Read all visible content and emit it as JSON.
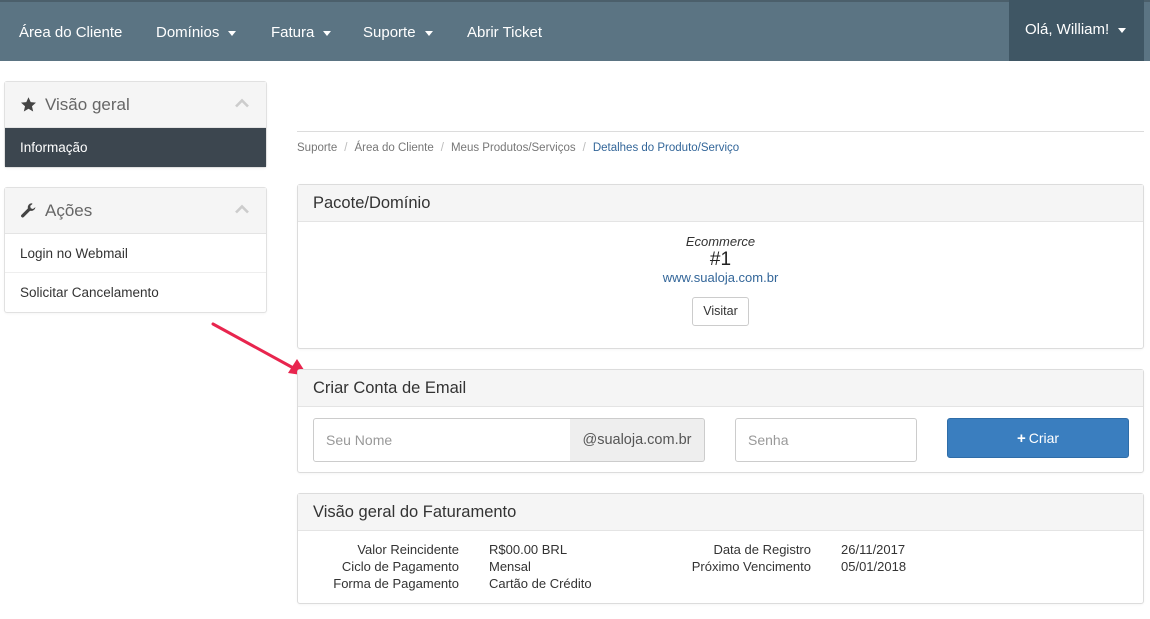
{
  "navbar": {
    "items": [
      {
        "label": "Área do Cliente",
        "dropdown": false
      },
      {
        "label": "Domínios",
        "dropdown": true
      },
      {
        "label": "Fatura",
        "dropdown": true
      },
      {
        "label": "Suporte",
        "dropdown": true
      },
      {
        "label": "Abrir Ticket",
        "dropdown": false
      }
    ],
    "user_greeting": "Olá, William!"
  },
  "sidebar": {
    "overview": {
      "title": "Visão geral",
      "icon": "star-icon",
      "items": [
        {
          "label": "Informação",
          "active": true
        }
      ]
    },
    "actions": {
      "title": "Ações",
      "icon": "wrench-icon",
      "items": [
        {
          "label": "Login no Webmail"
        },
        {
          "label": "Solicitar Cancelamento"
        }
      ]
    }
  },
  "breadcrumb": [
    "Suporte",
    "Área do Cliente",
    "Meus Produtos/Serviços",
    "Detalhes do Produto/Serviço"
  ],
  "package_panel": {
    "title": "Pacote/Domínio",
    "product_type": "Ecommerce",
    "product_number": "#1",
    "domain": "www.sualoja.com.br",
    "visit_label": "Visitar"
  },
  "email_panel": {
    "title": "Criar Conta de Email",
    "name_placeholder": "Seu Nome",
    "domain_suffix": "@sualoja.com.br",
    "password_placeholder": "Senha",
    "create_label": "Criar"
  },
  "billing_panel": {
    "title": "Visão geral do Faturamento",
    "left": [
      {
        "label": "Valor Reincidente",
        "value": "R$00.00 BRL"
      },
      {
        "label": "Ciclo de Pagamento",
        "value": "Mensal"
      },
      {
        "label": "Forma de Pagamento",
        "value": "Cartão de Crédito"
      }
    ],
    "right": [
      {
        "label": "Data de Registro",
        "value": "26/11/2017"
      },
      {
        "label": "Próximo Vencimento",
        "value": "05/01/2018"
      }
    ]
  },
  "colors": {
    "navbar": "#5b7483",
    "navbar_user": "#3f5664",
    "sidebar_active": "#3c464f",
    "primary_button": "#3a7ebf",
    "link": "#336699",
    "annotation_arrow": "#e8254e"
  }
}
